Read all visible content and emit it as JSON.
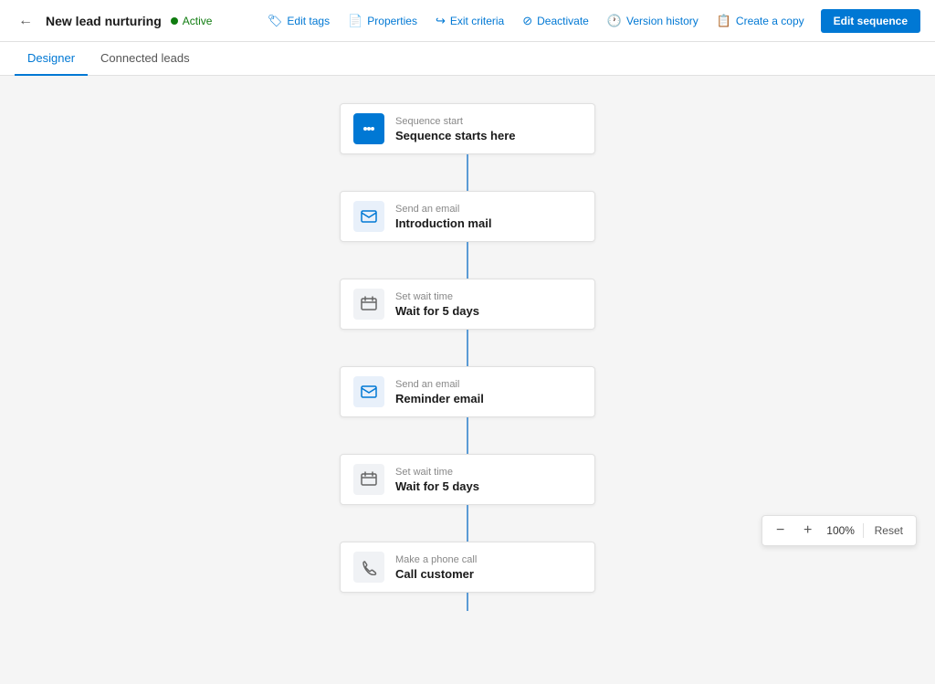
{
  "header": {
    "back_label": "←",
    "title": "New lead nurturing",
    "status": "Active",
    "actions": [
      {
        "id": "edit-tags",
        "label": "Edit tags",
        "icon": "🏷"
      },
      {
        "id": "properties",
        "label": "Properties",
        "icon": "📄"
      },
      {
        "id": "exit-criteria",
        "label": "Exit criteria",
        "icon": "↪"
      },
      {
        "id": "deactivate",
        "label": "Deactivate",
        "icon": "⊘"
      },
      {
        "id": "version-history",
        "label": "Version history",
        "icon": "🕐"
      },
      {
        "id": "create-copy",
        "label": "Create a copy",
        "icon": "📋"
      }
    ],
    "edit_button": "Edit sequence"
  },
  "tabs": [
    {
      "id": "designer",
      "label": "Designer",
      "active": true
    },
    {
      "id": "connected-leads",
      "label": "Connected leads",
      "active": false
    }
  ],
  "sequence": {
    "nodes": [
      {
        "id": "start",
        "icon_type": "blue-bg",
        "icon": "⚡",
        "label": "Sequence start",
        "title": "Sequence starts here"
      },
      {
        "id": "email-intro",
        "icon_type": "light-bg",
        "icon": "✉",
        "label": "Send an email",
        "title": "Introduction mail"
      },
      {
        "id": "wait-1",
        "icon_type": "gray-bg",
        "icon": "⏱",
        "label": "Set wait time",
        "title": "Wait for 5 days"
      },
      {
        "id": "email-reminder",
        "icon_type": "light-bg",
        "icon": "✉",
        "label": "Send an email",
        "title": "Reminder email"
      },
      {
        "id": "wait-2",
        "icon_type": "gray-bg",
        "icon": "⏱",
        "label": "Set wait time",
        "title": "Wait for 5 days"
      },
      {
        "id": "phone-call",
        "icon_type": "gray-bg",
        "icon": "📞",
        "label": "Make a phone call",
        "title": "Call customer"
      }
    ]
  },
  "zoom": {
    "value": "100%",
    "minus_label": "−",
    "plus_label": "+",
    "reset_label": "Reset"
  }
}
